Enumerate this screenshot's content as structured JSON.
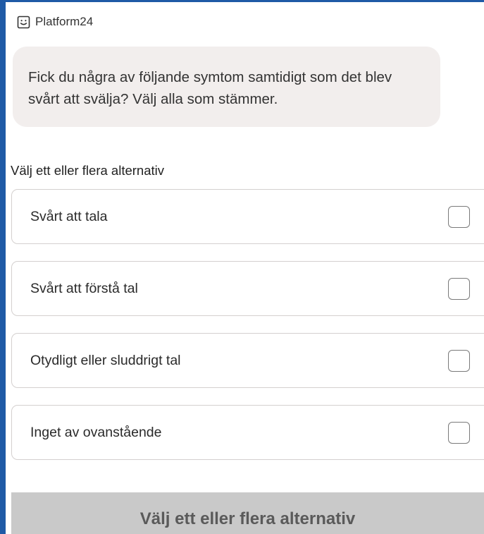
{
  "header": {
    "brand_icon": "chat-smile-icon",
    "brand_name": "Platform24"
  },
  "message": {
    "text": "Fick du några av följande symtom samtidigt som det blev svårt att svälja? Välj alla som stämmer."
  },
  "question": {
    "instruction": "Välj ett eller flera alternativ",
    "options": [
      {
        "label": "Svårt att tala",
        "checked": false
      },
      {
        "label": "Svårt att förstå tal",
        "checked": false
      },
      {
        "label": "Otydligt eller sluddrigt tal",
        "checked": false
      },
      {
        "label": "Inget av ovanstående",
        "checked": false
      }
    ]
  },
  "submit": {
    "label": "Välj ett eller flera alternativ",
    "enabled": false
  },
  "colors": {
    "frame": "#1f5aa6",
    "bubble_bg": "#f2eeed",
    "submit_disabled_bg": "#c9c9c9"
  }
}
